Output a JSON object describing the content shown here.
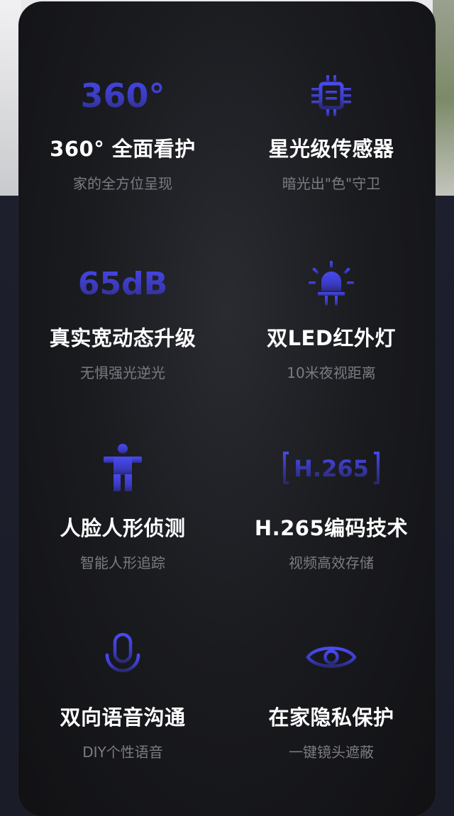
{
  "colors": {
    "accent": "#4747f0",
    "accent_dark": "#2c2c7a",
    "card_bg": "#151519",
    "title": "#ffffff",
    "subtitle": "#7b7c82"
  },
  "features": [
    {
      "icon": "360-degree-icon",
      "icon_text": "360°",
      "title": "360° 全面看护",
      "subtitle": "家的全方位呈现"
    },
    {
      "icon": "chip-sensor-icon",
      "title": "星光级传感器",
      "subtitle": "暗光出\"色\"守卫"
    },
    {
      "icon": "65db-icon",
      "icon_text": "65dB",
      "title": "真实宽动态升级",
      "subtitle": "无惧强光逆光"
    },
    {
      "icon": "led-light-icon",
      "title": "双LED红外灯",
      "subtitle": "10米夜视距离"
    },
    {
      "icon": "person-icon",
      "title": "人脸人形侦测",
      "subtitle": "智能人形追踪"
    },
    {
      "icon": "h265-icon",
      "icon_text": "H.265",
      "title": "H.265编码技术",
      "subtitle": "视频高效存储"
    },
    {
      "icon": "microphone-icon",
      "title": "双向语音沟通",
      "subtitle": "DIY个性语音"
    },
    {
      "icon": "eye-icon",
      "title": "在家隐私保护",
      "subtitle": "一键镜头遮蔽"
    }
  ]
}
